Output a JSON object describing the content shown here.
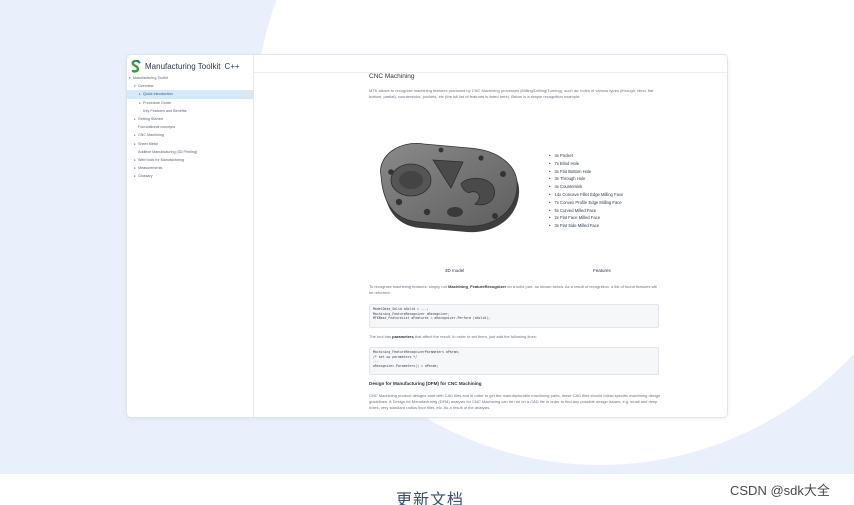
{
  "app": {
    "brand": "Manufacturing Toolkit",
    "lang": "C++"
  },
  "sidebar": {
    "items": [
      {
        "label": "Manufacturing Toolkit",
        "caret": "▾",
        "indent": 0,
        "active": false
      },
      {
        "label": "Overview",
        "caret": "▾",
        "indent": 1,
        "active": false
      },
      {
        "label": "Quick Introduction",
        "caret": "▸",
        "indent": 2,
        "active": true
      },
      {
        "label": "Procedure Guide",
        "caret": "▸",
        "indent": 2,
        "active": false
      },
      {
        "label": "Key Features and Benefits",
        "caret": "",
        "indent": 2,
        "active": false
      },
      {
        "label": "Getting Started",
        "caret": "▸",
        "indent": 1,
        "active": false
      },
      {
        "label": "Foundational concepts",
        "caret": "",
        "indent": 1,
        "active": false
      },
      {
        "label": "CNC Machining",
        "caret": "▸",
        "indent": 1,
        "active": false
      },
      {
        "label": "Sheet Metal",
        "caret": "▸",
        "indent": 1,
        "active": false
      },
      {
        "label": "Additive Manufacturing (3D Printing)",
        "caret": "",
        "indent": 1,
        "active": false
      },
      {
        "label": "Web tools for Manufacturing",
        "caret": "▸",
        "indent": 1,
        "active": false
      },
      {
        "label": "Measurements",
        "caret": "▸",
        "indent": 1,
        "active": false
      },
      {
        "label": "Glossary",
        "caret": "▸",
        "indent": 1,
        "active": false
      }
    ]
  },
  "content": {
    "title": "CNC Machining",
    "intro": "MTK allows to recognize machining features produced by CNC Machining processes (Milling/Drilling/Turning), such as: holes of various types (through, blind, flat bottom, partial), countersinks, pockets, etc (the full list of features is listed here). Below is a simple recognition example:",
    "features": [
      "4x Pocket",
      "7x Blind Hole",
      "3x Flat Bottom Hole",
      "3x Through Hole",
      "4x Countersink",
      "14x Concave Fillet Edge Milling Face",
      "7x Convex Profile Edge Milling Face",
      "5x Curved Milled Face",
      "2x Flat Face Milled Face",
      "3x Flat Side Milled Face"
    ],
    "caption_model": "3D model",
    "caption_features": "Features",
    "recognize_pre": "To recognize machining features, simply run ",
    "recognize_term": "Machining_FeatureRecognizer",
    "recognize_post": " on a solid part, as shown below. As a result of recognition, a list of found features will be returned:",
    "code1": "ModelData_Solid aSolid = ...;\nMachining_FeatureRecognizer aRecognizer;\nMTKBase_FeatureList aFeatures = aRecognizer.Perform (aSolid);",
    "params_pre": "The tool has ",
    "params_term": "parameters",
    "params_post": " that affect the result. In order to set them, just add the following lines:",
    "code2": "Machining_FeatureRecognizerParameters aParam;\n/* set up parameters */\n...\naRecognizer.Parameters() = aParam;",
    "dfm_heading": "Design for Manufacturing (DFM) for CNC Machining",
    "dfm_text": "CNC Machining product designs start with CAD files and in order to get the manufacturable machining parts, these CAD files should follow specific machining design guidelines. A Design for Manufacturing (DFM) analysis for CNC Machining can be run on a CAD file in order to find any possible design issues, e.g. small and deep holes, very standard radius floor fillet, etc. As a result of the analysis,"
  },
  "footer": {
    "title": "更新文档",
    "watermark": "CSDN @sdk大全"
  }
}
